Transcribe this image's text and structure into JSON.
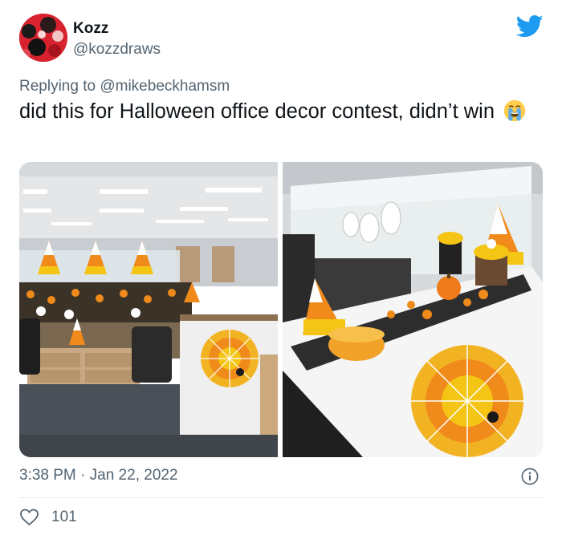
{
  "author": {
    "display_name": "Kozz",
    "handle": "@kozzdraws",
    "avatar_icon": "avatar-art"
  },
  "reply_context": {
    "prefix": "Replying to",
    "mention": "@mikebeckhamsm"
  },
  "tweet": {
    "text": "did this for Halloween office decor contest, didn’t win",
    "emoji": "loudly-crying-face-icon"
  },
  "media": {
    "photos": [
      {
        "subject": "office-cubicles-halloween-decor"
      },
      {
        "subject": "cubicle-desk-candy-corn-closeup"
      }
    ]
  },
  "meta": {
    "timestamp": "3:38 PM · Jan 22, 2022"
  },
  "engagement": {
    "like_count": "101"
  },
  "colors": {
    "brand": "#1d9bf0",
    "text": "#0f1419",
    "secondary": "#536471",
    "divider": "#e6ecf0"
  }
}
